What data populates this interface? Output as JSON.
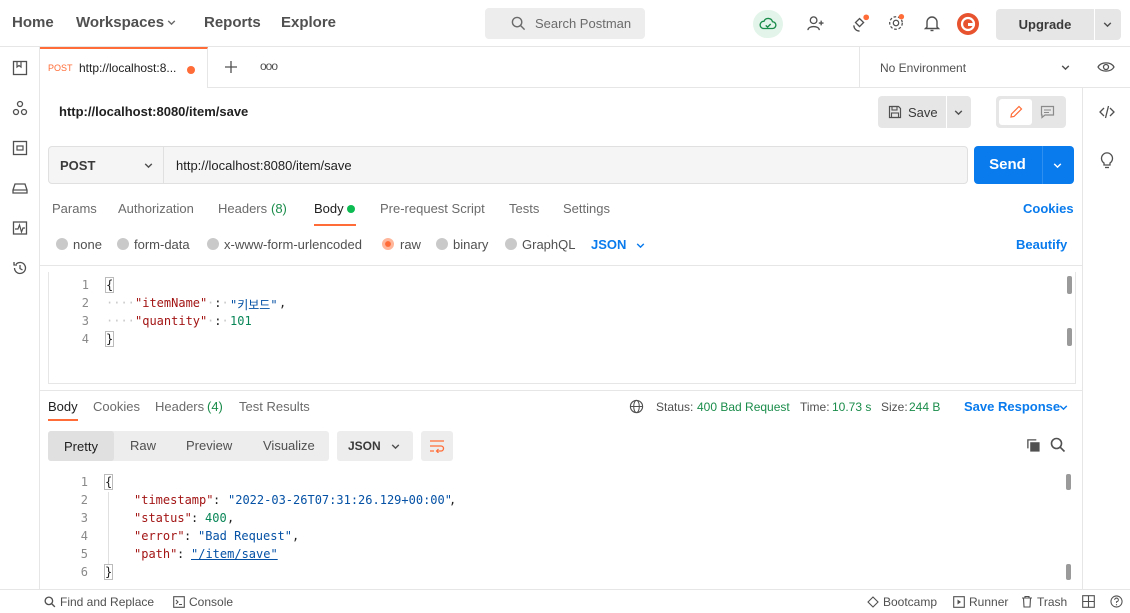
{
  "nav": {
    "home": "Home",
    "workspaces": "Workspaces",
    "reports": "Reports",
    "explore": "Explore",
    "search_placeholder": "Search Postman",
    "upgrade": "Upgrade"
  },
  "tab": {
    "method": "POST",
    "title": "http://localhost:8...",
    "more": "ooo"
  },
  "environment": "No Environment",
  "request": {
    "name": "http://localhost:8080/item/save",
    "save": "Save",
    "method": "POST",
    "url": "http://localhost:8080/item/save",
    "send": "Send"
  },
  "request_tabs": {
    "params": "Params",
    "authorization": "Authorization",
    "headers": "Headers",
    "headers_count": "(8)",
    "body": "Body",
    "prerequest": "Pre-request Script",
    "tests": "Tests",
    "settings": "Settings",
    "cookies": "Cookies"
  },
  "body_modes": {
    "none": "none",
    "form_data": "form-data",
    "urlencoded": "x-www-form-urlencoded",
    "raw": "raw",
    "binary": "binary",
    "graphql": "GraphQL",
    "format": "JSON",
    "beautify": "Beautify"
  },
  "request_body": {
    "lines": [
      "1",
      "2",
      "3",
      "4"
    ],
    "open": "{",
    "k1": "\"itemName\"",
    "v1": "\"키보드\"",
    "k2": "\"quantity\"",
    "v2": "101",
    "close": "}"
  },
  "response_tabs": {
    "body": "Body",
    "cookies": "Cookies",
    "headers": "Headers",
    "headers_count": "(4)",
    "tests": "Test Results"
  },
  "response_meta": {
    "status_label": "Status:",
    "status": "400 Bad Request",
    "time_label": "Time:",
    "time": "10.73 s",
    "size_label": "Size:",
    "size": "244 B",
    "save_response": "Save Response"
  },
  "response_view": {
    "pretty": "Pretty",
    "raw": "Raw",
    "preview": "Preview",
    "visualize": "Visualize",
    "format": "JSON"
  },
  "response_body": {
    "lines": [
      "1",
      "2",
      "3",
      "4",
      "5",
      "6"
    ],
    "open": "{",
    "k1": "\"timestamp\"",
    "v1": "\"2022-03-26T07:31:26.129+00:00\"",
    "k2": "\"status\"",
    "v2": "400",
    "k3": "\"error\"",
    "v3": "\"Bad Request\"",
    "k4": "\"path\"",
    "v4": "\"/item/save\"",
    "close": "}"
  },
  "footer": {
    "find": "Find and Replace",
    "console": "Console",
    "bootcamp": "Bootcamp",
    "runner": "Runner",
    "trash": "Trash"
  },
  "colors": {
    "accent": "#ff6c37",
    "send": "#097bed",
    "link": "#097bed",
    "status_ok": "#0cbb52"
  }
}
